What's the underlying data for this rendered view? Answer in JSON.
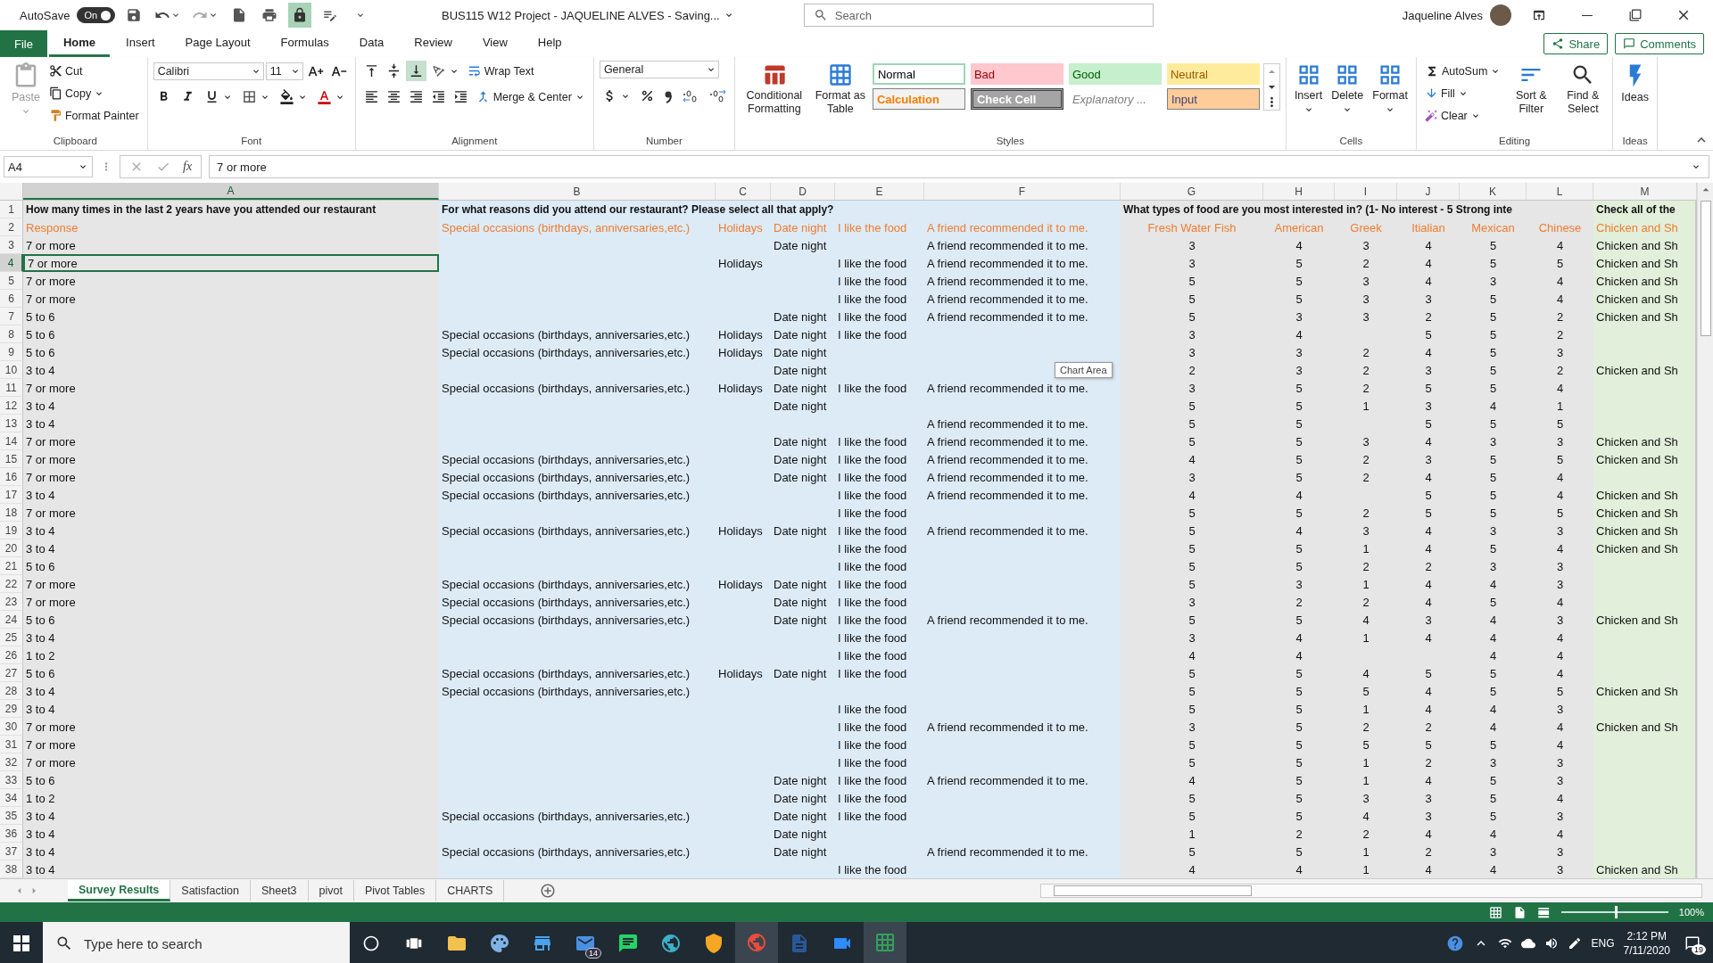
{
  "title_bar": {
    "autosave_label": "AutoSave",
    "autosave_state": "On",
    "autosave_on": true,
    "document_title": "BUS115 W12 Project - JAQUELINE ALVES -  Saving...",
    "search_placeholder": "Search",
    "user_name": "Jaqueline Alves"
  },
  "ribbon_tabs": [
    {
      "label": "File",
      "kind": "file",
      "selected": false
    },
    {
      "label": "Home",
      "kind": "tab",
      "selected": true
    },
    {
      "label": "Insert",
      "kind": "tab",
      "selected": false
    },
    {
      "label": "Page Layout",
      "kind": "tab",
      "selected": false
    },
    {
      "label": "Formulas",
      "kind": "tab",
      "selected": false
    },
    {
      "label": "Data",
      "kind": "tab",
      "selected": false
    },
    {
      "label": "Review",
      "kind": "tab",
      "selected": false
    },
    {
      "label": "View",
      "kind": "tab",
      "selected": false
    },
    {
      "label": "Help",
      "kind": "tab",
      "selected": false
    }
  ],
  "share": "Share",
  "comments": "Comments",
  "clipboard": {
    "label": "Clipboard",
    "paste": "Paste",
    "cut": "Cut",
    "copy": "Copy",
    "format_painter": "Format Painter"
  },
  "font": {
    "label": "Font",
    "name": "Calibri",
    "size": "11"
  },
  "alignment": {
    "label": "Alignment",
    "wrap_text": "Wrap Text",
    "merge_center": "Merge & Center"
  },
  "number": {
    "label": "Number",
    "format": "General"
  },
  "styles": {
    "label": "Styles",
    "conditional_formatting": "Conditional Formatting",
    "format_as_table": "Format as Table",
    "cell_styles": [
      {
        "label": "Normal",
        "kind": "normal"
      },
      {
        "label": "Bad",
        "kind": "bad"
      },
      {
        "label": "Good",
        "kind": "good"
      },
      {
        "label": "Neutral",
        "kind": "neutral"
      },
      {
        "label": "Calculation",
        "kind": "calculation"
      },
      {
        "label": "Check Cell",
        "kind": "check"
      },
      {
        "label": "Explanatory ...",
        "kind": "explanatory"
      },
      {
        "label": "Input",
        "kind": "input"
      }
    ]
  },
  "cells": {
    "label": "Cells",
    "commands": [
      "Insert",
      "Delete",
      "Format"
    ]
  },
  "editing": {
    "label": "Editing",
    "autosum": "AutoSum",
    "fill": "Fill",
    "clear": "Clear",
    "sort_filter": "Sort & Filter",
    "find_select": "Find & Select"
  },
  "ideas": {
    "label": "Ideas",
    "button": "Ideas"
  },
  "formula_bar": {
    "name_box": "A4",
    "function_label": "fx",
    "formula": "7 or more"
  },
  "sheet": {
    "tooltip": "Chart Area",
    "columns": [
      {
        "label": "A",
        "selected": true
      },
      {
        "label": "B",
        "selected": false
      },
      {
        "label": "C",
        "selected": false
      },
      {
        "label": "D",
        "selected": false
      },
      {
        "label": "E",
        "selected": false
      },
      {
        "label": "F",
        "selected": false
      },
      {
        "label": "G",
        "selected": false
      },
      {
        "label": "H",
        "selected": false
      },
      {
        "label": "I",
        "selected": false
      },
      {
        "label": "J",
        "selected": false
      },
      {
        "label": "K",
        "selected": false
      },
      {
        "label": "L",
        "selected": false
      },
      {
        "label": "M",
        "selected": false
      }
    ],
    "rows": [
      {
        "n": "1",
        "kind": "question",
        "selected": false,
        "A": "How many times in the last 2 years have you attended our restaurant",
        "B": "For what reasons did you attend our restaurant? Please select all that apply?",
        "G": "What types of food are you most interested in? (1- No interest - 5 Strong inte",
        "M": "Check all of the"
      },
      {
        "n": "2",
        "kind": "heading",
        "selected": false,
        "A": "Response",
        "B": "Special occasions (birthdays, anniversaries,etc.)",
        "C": "Holidays",
        "D": "Date night",
        "E": "I like the food",
        "F": "A friend recommended it to me.",
        "G": "Fresh Water Fish",
        "H": "American",
        "I": "Greek",
        "J": "Itialian",
        "K": "Mexican",
        "L": "Chinese",
        "M": "Chicken and Sh"
      },
      {
        "n": "3",
        "kind": "data",
        "selected": false,
        "A": "7 or more",
        "D": "Date night",
        "F": "A friend recommended it to me.",
        "G": "3",
        "H": "4",
        "I": "3",
        "J": "4",
        "K": "5",
        "L": "4",
        "M": "Chicken and Sh"
      },
      {
        "n": "4",
        "kind": "data",
        "selected": true,
        "A": "7 or more",
        "C": "Holidays",
        "E": "I like the food",
        "F": "A friend recommended it to me.",
        "G": "3",
        "H": "5",
        "I": "2",
        "J": "4",
        "K": "5",
        "L": "5",
        "M": "Chicken and Sh"
      },
      {
        "n": "5",
        "kind": "data",
        "selected": false,
        "A": "7 or more",
        "E": "I like the food",
        "F": "A friend recommended it to me.",
        "G": "5",
        "H": "5",
        "I": "3",
        "J": "4",
        "K": "3",
        "L": "4",
        "M": "Chicken and Sh"
      },
      {
        "n": "6",
        "kind": "data",
        "selected": false,
        "A": "7 or more",
        "E": "I like the food",
        "F": "A friend recommended it to me.",
        "G": "5",
        "H": "5",
        "I": "3",
        "J": "3",
        "K": "5",
        "L": "4",
        "M": "Chicken and Sh"
      },
      {
        "n": "7",
        "kind": "data",
        "selected": false,
        "A": "5 to 6",
        "D": "Date night",
        "E": "I like the food",
        "F": "A friend recommended it to me.",
        "G": "5",
        "H": "3",
        "I": "3",
        "J": "2",
        "K": "5",
        "L": "2",
        "M": "Chicken and Sh"
      },
      {
        "n": "8",
        "kind": "data",
        "selected": false,
        "A": "5 to 6",
        "B": "Special occasions (birthdays, anniversaries,etc.)",
        "C": "Holidays",
        "D": "Date night",
        "E": "I like the food",
        "G": "3",
        "H": "4",
        "J": "5",
        "K": "5",
        "L": "2"
      },
      {
        "n": "9",
        "kind": "data",
        "selected": false,
        "A": "5 to 6",
        "B": "Special occasions (birthdays, anniversaries,etc.)",
        "C": "Holidays",
        "D": "Date night",
        "G": "3",
        "H": "3",
        "I": "2",
        "J": "4",
        "K": "5",
        "L": "3"
      },
      {
        "n": "10",
        "kind": "data",
        "selected": false,
        "A": "3 to 4",
        "D": "Date night",
        "G": "2",
        "H": "3",
        "I": "2",
        "J": "3",
        "K": "5",
        "L": "2",
        "M": "Chicken and Sh"
      },
      {
        "n": "11",
        "kind": "data",
        "selected": false,
        "A": "7 or more",
        "B": "Special occasions (birthdays, anniversaries,etc.)",
        "C": "Holidays",
        "D": "Date night",
        "E": "I like the food",
        "F": "A friend recommended it to me.",
        "G": "3",
        "H": "5",
        "I": "2",
        "J": "5",
        "K": "5",
        "L": "4"
      },
      {
        "n": "12",
        "kind": "data",
        "selected": false,
        "A": "3 to 4",
        "D": "Date night",
        "G": "5",
        "H": "5",
        "I": "1",
        "J": "3",
        "K": "4",
        "L": "1"
      },
      {
        "n": "13",
        "kind": "data",
        "selected": false,
        "A": "3 to 4",
        "F": "A friend recommended it to me.",
        "G": "5",
        "H": "5",
        "J": "5",
        "K": "5",
        "L": "5"
      },
      {
        "n": "14",
        "kind": "data",
        "selected": false,
        "A": "7 or more",
        "D": "Date night",
        "E": "I like the food",
        "F": "A friend recommended it to me.",
        "G": "5",
        "H": "5",
        "I": "3",
        "J": "4",
        "K": "3",
        "L": "3",
        "M": "Chicken and Sh"
      },
      {
        "n": "15",
        "kind": "data",
        "selected": false,
        "A": "7 or more",
        "B": "Special occasions (birthdays, anniversaries,etc.)",
        "D": "Date night",
        "E": "I like the food",
        "F": "A friend recommended it to me.",
        "G": "4",
        "H": "5",
        "I": "2",
        "J": "3",
        "K": "5",
        "L": "5",
        "M": "Chicken and Sh"
      },
      {
        "n": "16",
        "kind": "data",
        "selected": false,
        "A": "7 or more",
        "B": "Special occasions (birthdays, anniversaries,etc.)",
        "D": "Date night",
        "E": "I like the food",
        "F": "A friend recommended it to me.",
        "G": "3",
        "H": "5",
        "I": "2",
        "J": "4",
        "K": "5",
        "L": "4"
      },
      {
        "n": "17",
        "kind": "data",
        "selected": false,
        "A": "3 to 4",
        "B": "Special occasions (birthdays, anniversaries,etc.)",
        "E": "I like the food",
        "F": "A friend recommended it to me.",
        "G": "4",
        "H": "4",
        "J": "5",
        "K": "5",
        "L": "4",
        "M": "Chicken and Sh"
      },
      {
        "n": "18",
        "kind": "data",
        "selected": false,
        "A": "7 or more",
        "E": "I like the food",
        "G": "5",
        "H": "5",
        "I": "2",
        "J": "5",
        "K": "5",
        "L": "5",
        "M": "Chicken and Sh"
      },
      {
        "n": "19",
        "kind": "data",
        "selected": false,
        "A": "3 to 4",
        "B": "Special occasions (birthdays, anniversaries,etc.)",
        "C": "Holidays",
        "D": "Date night",
        "E": "I like the food",
        "F": "A friend recommended it to me.",
        "G": "5",
        "H": "4",
        "I": "3",
        "J": "4",
        "K": "3",
        "L": "3",
        "M": "Chicken and Sh"
      },
      {
        "n": "20",
        "kind": "data",
        "selected": false,
        "A": "3 to 4",
        "E": "I like the food",
        "G": "5",
        "H": "5",
        "I": "1",
        "J": "4",
        "K": "5",
        "L": "4",
        "M": "Chicken and Sh"
      },
      {
        "n": "21",
        "kind": "data",
        "selected": false,
        "A": "5 to 6",
        "E": "I like the food",
        "G": "5",
        "H": "5",
        "I": "2",
        "J": "2",
        "K": "3",
        "L": "3"
      },
      {
        "n": "22",
        "kind": "data",
        "selected": false,
        "A": "7 or more",
        "B": "Special occasions (birthdays, anniversaries,etc.)",
        "C": "Holidays",
        "D": "Date night",
        "E": "I like the food",
        "G": "5",
        "H": "3",
        "I": "1",
        "J": "4",
        "K": "4",
        "L": "3"
      },
      {
        "n": "23",
        "kind": "data",
        "selected": false,
        "A": "7 or more",
        "B": "Special occasions (birthdays, anniversaries,etc.)",
        "D": "Date night",
        "E": "I like the food",
        "G": "3",
        "H": "2",
        "I": "2",
        "J": "4",
        "K": "5",
        "L": "4"
      },
      {
        "n": "24",
        "kind": "data",
        "selected": false,
        "A": "5 to 6",
        "B": "Special occasions (birthdays, anniversaries,etc.)",
        "D": "Date night",
        "E": "I like the food",
        "F": "A friend recommended it to me.",
        "G": "5",
        "H": "5",
        "I": "4",
        "J": "3",
        "K": "4",
        "L": "3",
        "M": "Chicken and Sh"
      },
      {
        "n": "25",
        "kind": "data",
        "selected": false,
        "A": "3 to 4",
        "E": "I like the food",
        "G": "3",
        "H": "4",
        "I": "1",
        "J": "4",
        "K": "4",
        "L": "4"
      },
      {
        "n": "26",
        "kind": "data",
        "selected": false,
        "A": "1 to 2",
        "E": "I like the food",
        "G": "4",
        "H": "4",
        "K": "4",
        "L": "4"
      },
      {
        "n": "27",
        "kind": "data",
        "selected": false,
        "A": "5 to 6",
        "B": "Special occasions (birthdays, anniversaries,etc.)",
        "C": "Holidays",
        "D": "Date night",
        "E": "I like the food",
        "G": "5",
        "H": "5",
        "I": "4",
        "J": "5",
        "K": "5",
        "L": "4"
      },
      {
        "n": "28",
        "kind": "data",
        "selected": false,
        "A": "3 to 4",
        "B": "Special occasions (birthdays, anniversaries,etc.)",
        "G": "5",
        "H": "5",
        "I": "5",
        "J": "4",
        "K": "5",
        "L": "5",
        "M": "Chicken and Sh"
      },
      {
        "n": "29",
        "kind": "data",
        "selected": false,
        "A": "3 to 4",
        "E": "I like the food",
        "G": "5",
        "H": "5",
        "I": "1",
        "J": "4",
        "K": "4",
        "L": "3"
      },
      {
        "n": "30",
        "kind": "data",
        "selected": false,
        "A": "7 or more",
        "E": "I like the food",
        "F": "A friend recommended it to me.",
        "G": "3",
        "H": "5",
        "I": "2",
        "J": "2",
        "K": "4",
        "L": "4",
        "M": "Chicken and Sh"
      },
      {
        "n": "31",
        "kind": "data",
        "selected": false,
        "A": "7 or more",
        "E": "I like the food",
        "G": "5",
        "H": "5",
        "I": "5",
        "J": "5",
        "K": "5",
        "L": "4"
      },
      {
        "n": "32",
        "kind": "data",
        "selected": false,
        "A": "7 or more",
        "E": "I like the food",
        "G": "5",
        "H": "5",
        "I": "1",
        "J": "2",
        "K": "3",
        "L": "3"
      },
      {
        "n": "33",
        "kind": "data",
        "selected": false,
        "A": "5 to 6",
        "D": "Date night",
        "E": "I like the food",
        "F": "A friend recommended it to me.",
        "G": "4",
        "H": "5",
        "I": "1",
        "J": "4",
        "K": "5",
        "L": "3"
      },
      {
        "n": "34",
        "kind": "data",
        "selected": false,
        "A": "1 to 2",
        "D": "Date night",
        "E": "I like the food",
        "G": "5",
        "H": "5",
        "I": "3",
        "J": "3",
        "K": "5",
        "L": "4"
      },
      {
        "n": "35",
        "kind": "data",
        "selected": false,
        "A": "3 to 4",
        "B": "Special occasions (birthdays, anniversaries,etc.)",
        "D": "Date night",
        "E": "I like the food",
        "G": "5",
        "H": "5",
        "I": "4",
        "J": "3",
        "K": "5",
        "L": "3"
      },
      {
        "n": "36",
        "kind": "data",
        "selected": false,
        "A": "3 to 4",
        "D": "Date night",
        "G": "1",
        "H": "2",
        "I": "2",
        "J": "4",
        "K": "4",
        "L": "4"
      },
      {
        "n": "37",
        "kind": "data",
        "selected": false,
        "A": "3 to 4",
        "B": "Special occasions (birthdays, anniversaries,etc.)",
        "D": "Date night",
        "F": "A friend recommended it to me.",
        "G": "5",
        "H": "5",
        "I": "1",
        "J": "2",
        "K": "3",
        "L": "3"
      },
      {
        "n": "38",
        "kind": "data",
        "selected": false,
        "A": "3 to 4",
        "E": "I like the food",
        "G": "4",
        "H": "4",
        "I": "1",
        "J": "4",
        "K": "4",
        "L": "3",
        "M": "Chicken and Sh"
      }
    ]
  },
  "sheet_tabs": [
    {
      "label": "Survey Results",
      "selected": true
    },
    {
      "label": "Satisfaction",
      "selected": false
    },
    {
      "label": "Sheet3",
      "selected": false
    },
    {
      "label": "pivot",
      "selected": false
    },
    {
      "label": "Pivot Tables",
      "selected": false
    },
    {
      "label": "CHARTS",
      "selected": false
    }
  ],
  "status_bar": {
    "zoom": "100%",
    "zoom_slider": {
      "level": 0.5
    }
  },
  "taskbar": {
    "search_placeholder": "Type here to search",
    "mail_badge": "14",
    "language": "ENG",
    "time": "2:12 PM",
    "date": "7/11/2020",
    "notification_count": "19"
  }
}
